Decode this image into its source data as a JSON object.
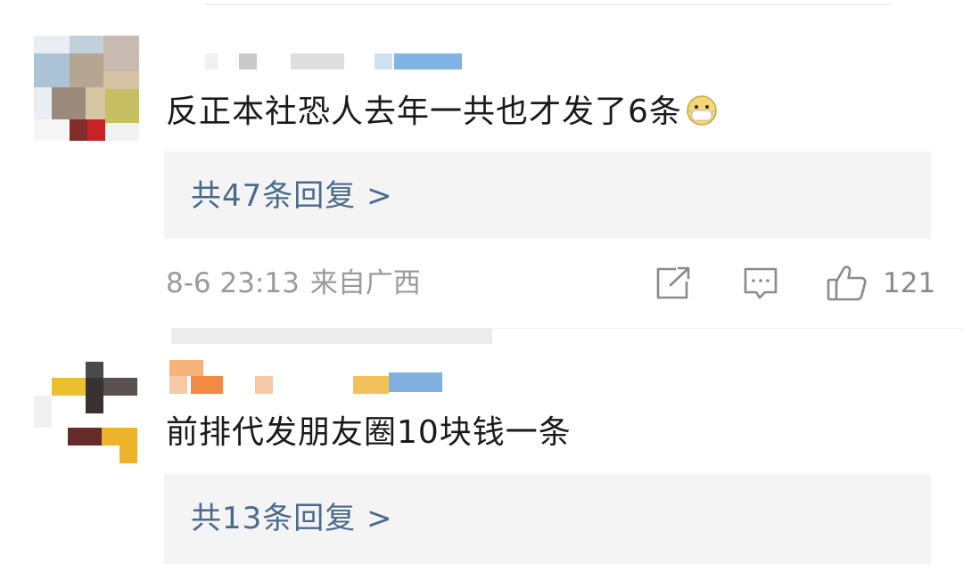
{
  "comments": [
    {
      "text": "反正本社恐人去年一共也才发了6条",
      "emoji": "mask-face-emoji",
      "reply_summary": "共47条回复 >",
      "timestamp": "8-6 23:13",
      "location": "来自广西",
      "likes": "121"
    },
    {
      "text": "前排代发朋友圈10块钱一条",
      "reply_summary": "共13条回复 >"
    }
  ],
  "icons": {
    "share": "share-icon",
    "comment": "comment-icon",
    "like": "thumbs-up-icon"
  },
  "colors": {
    "reply_link": "#4a6a8a",
    "meta_text": "#9a9a9a",
    "reply_bg": "#f4f4f5"
  }
}
